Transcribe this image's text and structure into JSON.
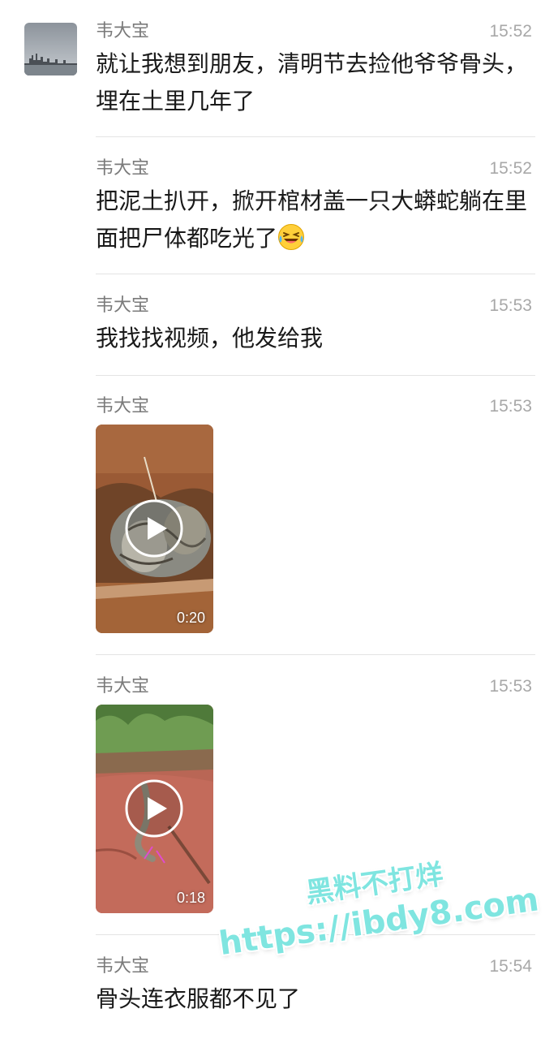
{
  "messages": [
    {
      "sender": "韦大宝",
      "time": "15:52",
      "text": "就让我想到朋友，清明节去捡他爷爷骨头，埋在土里几年了"
    },
    {
      "sender": "韦大宝",
      "time": "15:52",
      "text": "把泥土扒开，掀开棺材盖一只大蟒蛇躺在里面把尸体都吃光了",
      "emoji": "crying-laughing-face"
    },
    {
      "sender": "韦大宝",
      "time": "15:53",
      "text": "我找找视频，他发给我"
    },
    {
      "sender": "韦大宝",
      "time": "15:53",
      "video_duration": "0:20"
    },
    {
      "sender": "韦大宝",
      "time": "15:53",
      "video_duration": "0:18"
    },
    {
      "sender": "韦大宝",
      "time": "15:54",
      "text": "骨头连衣服都不见了"
    }
  ],
  "watermark": {
    "line1": "黑料不打烊",
    "line2": "https://ibdy8.com",
    "color": "#7fe5e0"
  }
}
